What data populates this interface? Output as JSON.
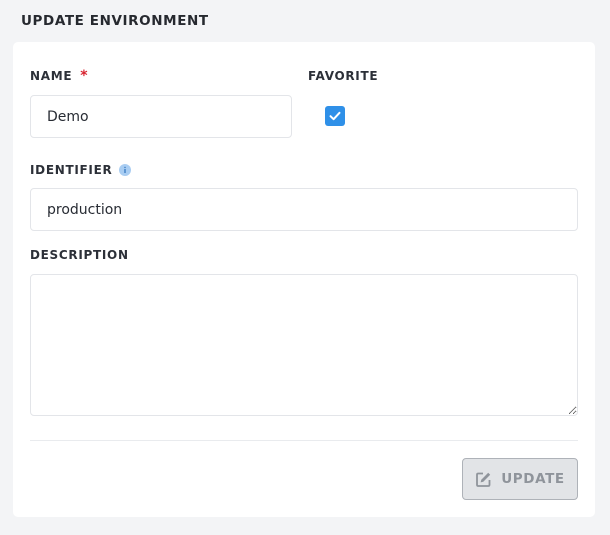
{
  "header": {
    "title": "UPDATE ENVIRONMENT"
  },
  "form": {
    "name": {
      "label": "NAME",
      "required_mark": "*",
      "value": "Demo"
    },
    "favorite": {
      "label": "FAVORITE",
      "checked": true
    },
    "identifier": {
      "label": "IDENTIFIER",
      "info_icon": "info-icon",
      "value": "production"
    },
    "description": {
      "label": "DESCRIPTION",
      "value": ""
    }
  },
  "actions": {
    "update_label": "UPDATE",
    "update_icon": "edit-icon",
    "update_disabled": true
  },
  "colors": {
    "accent": "#2f90e8",
    "required": "#d8222f",
    "disabled_text": "#8f949b"
  }
}
